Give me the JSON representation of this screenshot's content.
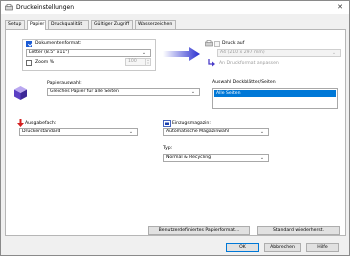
{
  "window": {
    "title": "Druckeinstellungen",
    "close_glyph": "✕"
  },
  "tabs": [
    {
      "label": "Setup"
    },
    {
      "label": "Papier"
    },
    {
      "label": "Druckqualität"
    },
    {
      "label": "Gültiger Zugriff"
    },
    {
      "label": "Wasserzeichen"
    }
  ],
  "active_tab": "Papier",
  "paper": {
    "document_format": {
      "label": "Dokumentenformat:",
      "checked": true,
      "value": "Letter (8.5\" x11\")"
    },
    "zoom": {
      "label": "Zoom %",
      "checked": false,
      "value": "100"
    },
    "print_to": {
      "label": "Druck auf",
      "checked": false,
      "value": "A4 (210 x 297 mm)"
    },
    "fit_to_page": {
      "label": "An Druckformat anpassen"
    },
    "paper_selection": {
      "label": "Papierauswahl:",
      "value": "Gleiches Papier für alle Seiten"
    },
    "cover_selection": {
      "label": "Auswahl Deckblätter/Seiten",
      "items": [
        "Alle Seiten"
      ]
    },
    "output_tray": {
      "label": "Ausgabefach:",
      "value": "Druckerstandard"
    },
    "input_tray": {
      "label": "Einzugsmagazin:",
      "value": "Automatische Magazinwahl"
    },
    "type": {
      "label": "Typ:",
      "value": "Normal & Recycling"
    }
  },
  "buttons": {
    "custom_paper_format": "Benutzerdefiniertes Papierformat...",
    "restore_default": "Standard wiederherst.",
    "ok": "OK",
    "cancel": "Abbrechen",
    "help": "Hilfe"
  },
  "colors": {
    "accent": "#1a5bd6",
    "selection": "#0078d7",
    "purple": "#5b3fc4",
    "red": "#d42020"
  },
  "icons": {
    "app": "printer-settings-icon",
    "paper": "paper-stack-icon",
    "fit_arrow": "redirect-arrow-icon",
    "output": "output-tray-arrow-icon",
    "input": "input-tray-icon",
    "convert": "arrow-right-icon",
    "printer": "printer-icon",
    "cube": "paper-cube-icon"
  }
}
